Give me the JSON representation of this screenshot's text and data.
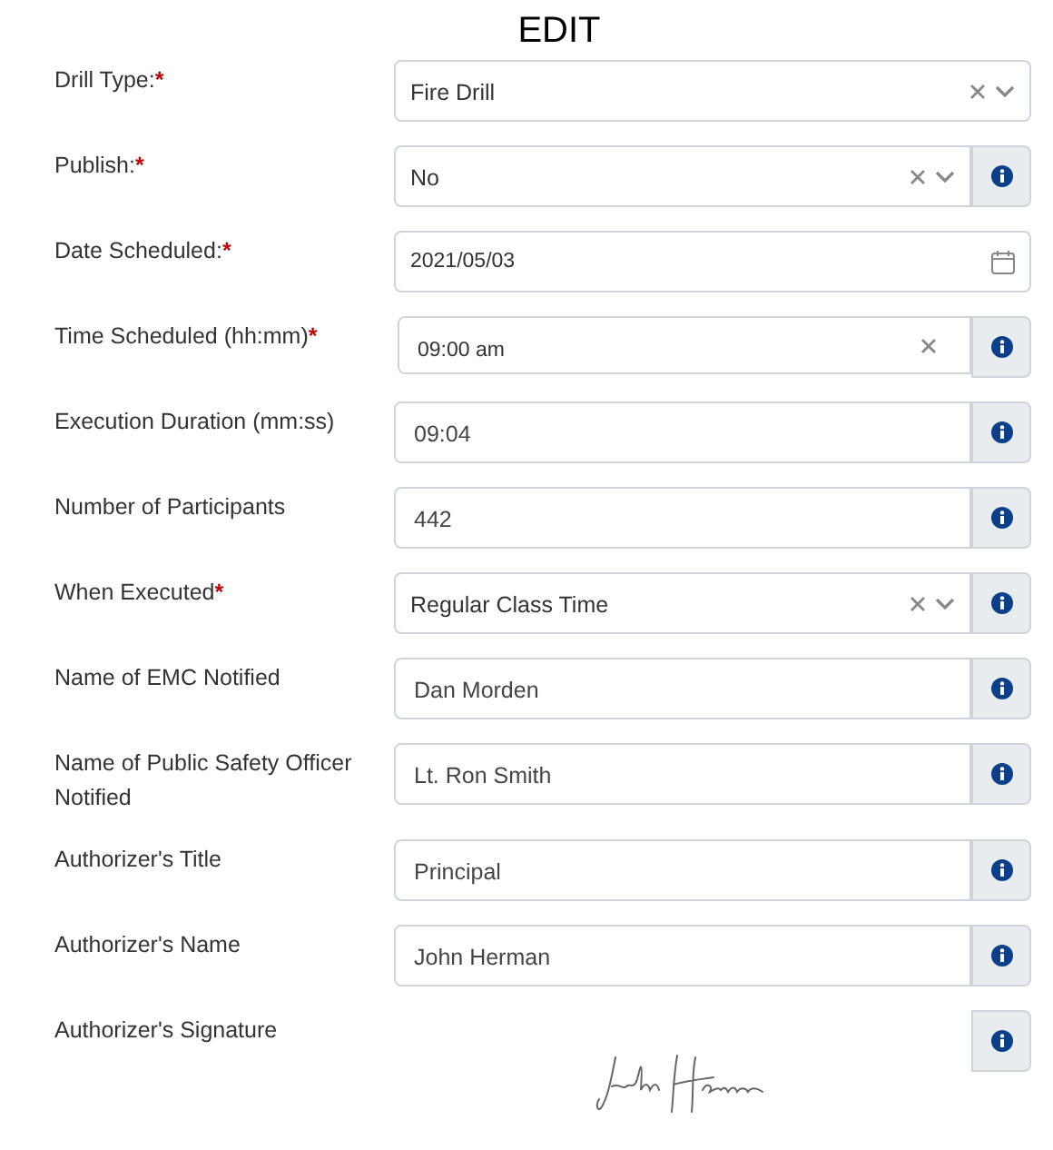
{
  "title": "EDIT",
  "fields": [
    {
      "kind": "select",
      "label": "Drill Type:",
      "required_mark": "*",
      "value": "Fire Drill",
      "info": false
    },
    {
      "kind": "select",
      "label": "Publish:",
      "required_mark": "*",
      "value": "No",
      "info": true
    },
    {
      "kind": "date",
      "label": "Date Scheduled:",
      "required_mark": "*",
      "value": "2021/05/03",
      "info": false
    },
    {
      "kind": "time",
      "label": "Time Scheduled (hh:mm)",
      "required_mark": "*",
      "value": "09:00 am",
      "info": true
    },
    {
      "kind": "text",
      "label": "Execution Duration (mm:ss)",
      "value": "09:04",
      "info": true
    },
    {
      "kind": "text",
      "label": "Number of Participants",
      "value": "442",
      "info": true
    },
    {
      "kind": "select",
      "label": "When Executed",
      "required_mark": "*",
      "value": "Regular Class Time",
      "info": true
    },
    {
      "kind": "text",
      "label": "Name of EMC Notified",
      "value": "Dan Morden",
      "info": true
    },
    {
      "kind": "text",
      "label": "Name of Public Safety Officer Notified",
      "value": "Lt. Ron Smith",
      "info": true
    },
    {
      "kind": "text",
      "label": "Authorizer's Title",
      "value": "Principal",
      "info": true
    },
    {
      "kind": "text",
      "label": "Authorizer's Name",
      "value": "John Herman",
      "info": true
    },
    {
      "kind": "signature",
      "label": "Authorizer's Signature",
      "info": true
    }
  ]
}
